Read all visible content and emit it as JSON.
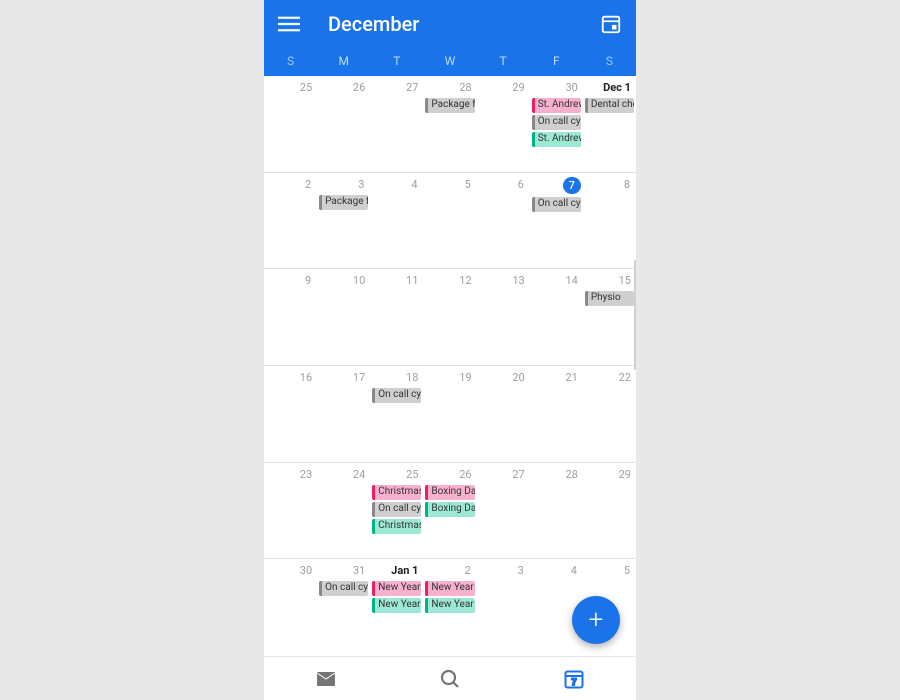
{
  "header": {
    "title": "December"
  },
  "weekdays": [
    "S",
    "M",
    "T",
    "W",
    "T",
    "F",
    "S"
  ],
  "weeks": [
    {
      "days": [
        {
          "n": "25",
          "inMonth": false,
          "events": []
        },
        {
          "n": "26",
          "inMonth": false,
          "events": []
        },
        {
          "n": "27",
          "inMonth": false,
          "events": []
        },
        {
          "n": "28",
          "inMonth": false,
          "events": [
            {
              "t": "Package f",
              "c": "gray"
            }
          ]
        },
        {
          "n": "29",
          "inMonth": false,
          "events": []
        },
        {
          "n": "30",
          "inMonth": false,
          "events": [
            {
              "t": "St. Andrew",
              "c": "pink"
            },
            {
              "t": "On call cy",
              "c": "gray"
            },
            {
              "t": "St. Andrew",
              "c": "teal"
            }
          ]
        },
        {
          "n": "Dec 1",
          "inMonth": true,
          "monthStart": true,
          "events": [
            {
              "t": "Dental che",
              "c": "gray"
            }
          ]
        }
      ]
    },
    {
      "days": [
        {
          "n": "2",
          "inMonth": true,
          "events": []
        },
        {
          "n": "3",
          "inMonth": true,
          "events": [
            {
              "t": "Package f",
              "c": "gray"
            }
          ]
        },
        {
          "n": "4",
          "inMonth": true,
          "events": []
        },
        {
          "n": "5",
          "inMonth": true,
          "events": []
        },
        {
          "n": "6",
          "inMonth": true,
          "events": []
        },
        {
          "n": "7",
          "inMonth": true,
          "today": true,
          "events": [
            {
              "t": "On call cy",
              "c": "gray"
            }
          ]
        },
        {
          "n": "8",
          "inMonth": true,
          "events": []
        }
      ]
    },
    {
      "days": [
        {
          "n": "9",
          "inMonth": true,
          "events": []
        },
        {
          "n": "10",
          "inMonth": true,
          "events": []
        },
        {
          "n": "11",
          "inMonth": true,
          "events": []
        },
        {
          "n": "12",
          "inMonth": true,
          "events": []
        },
        {
          "n": "13",
          "inMonth": true,
          "events": []
        },
        {
          "n": "14",
          "inMonth": true,
          "events": []
        },
        {
          "n": "15",
          "inMonth": true,
          "events": [
            {
              "t": "Physio",
              "c": "gray"
            }
          ]
        }
      ]
    },
    {
      "days": [
        {
          "n": "16",
          "inMonth": true,
          "events": []
        },
        {
          "n": "17",
          "inMonth": true,
          "events": []
        },
        {
          "n": "18",
          "inMonth": true,
          "events": [
            {
              "t": "On call cy",
              "c": "gray"
            }
          ]
        },
        {
          "n": "19",
          "inMonth": true,
          "events": []
        },
        {
          "n": "20",
          "inMonth": true,
          "events": []
        },
        {
          "n": "21",
          "inMonth": true,
          "events": []
        },
        {
          "n": "22",
          "inMonth": true,
          "events": []
        }
      ]
    },
    {
      "days": [
        {
          "n": "23",
          "inMonth": true,
          "events": []
        },
        {
          "n": "24",
          "inMonth": true,
          "events": []
        },
        {
          "n": "25",
          "inMonth": true,
          "events": [
            {
              "t": "Christmas",
              "c": "pink"
            },
            {
              "t": "On call cy",
              "c": "gray"
            },
            {
              "t": "Christmas",
              "c": "teal"
            }
          ]
        },
        {
          "n": "26",
          "inMonth": true,
          "events": [
            {
              "t": "Boxing Da",
              "c": "pink"
            },
            {
              "t": "Boxing Da",
              "c": "teal"
            }
          ]
        },
        {
          "n": "27",
          "inMonth": true,
          "events": []
        },
        {
          "n": "28",
          "inMonth": true,
          "events": []
        },
        {
          "n": "29",
          "inMonth": true,
          "events": []
        }
      ]
    },
    {
      "days": [
        {
          "n": "30",
          "inMonth": true,
          "events": []
        },
        {
          "n": "31",
          "inMonth": true,
          "events": [
            {
              "t": "On call cy",
              "c": "gray"
            }
          ]
        },
        {
          "n": "Jan 1",
          "inMonth": false,
          "monthStart": true,
          "events": [
            {
              "t": "New Year",
              "c": "pink"
            },
            {
              "t": "New Year",
              "c": "teal"
            }
          ]
        },
        {
          "n": "2",
          "inMonth": false,
          "events": [
            {
              "t": "New Year",
              "c": "pink"
            },
            {
              "t": "New Year",
              "c": "teal"
            }
          ]
        },
        {
          "n": "3",
          "inMonth": false,
          "events": []
        },
        {
          "n": "4",
          "inMonth": false,
          "events": []
        },
        {
          "n": "5",
          "inMonth": false,
          "events": []
        }
      ]
    }
  ],
  "fab": {
    "glyph": "+"
  }
}
